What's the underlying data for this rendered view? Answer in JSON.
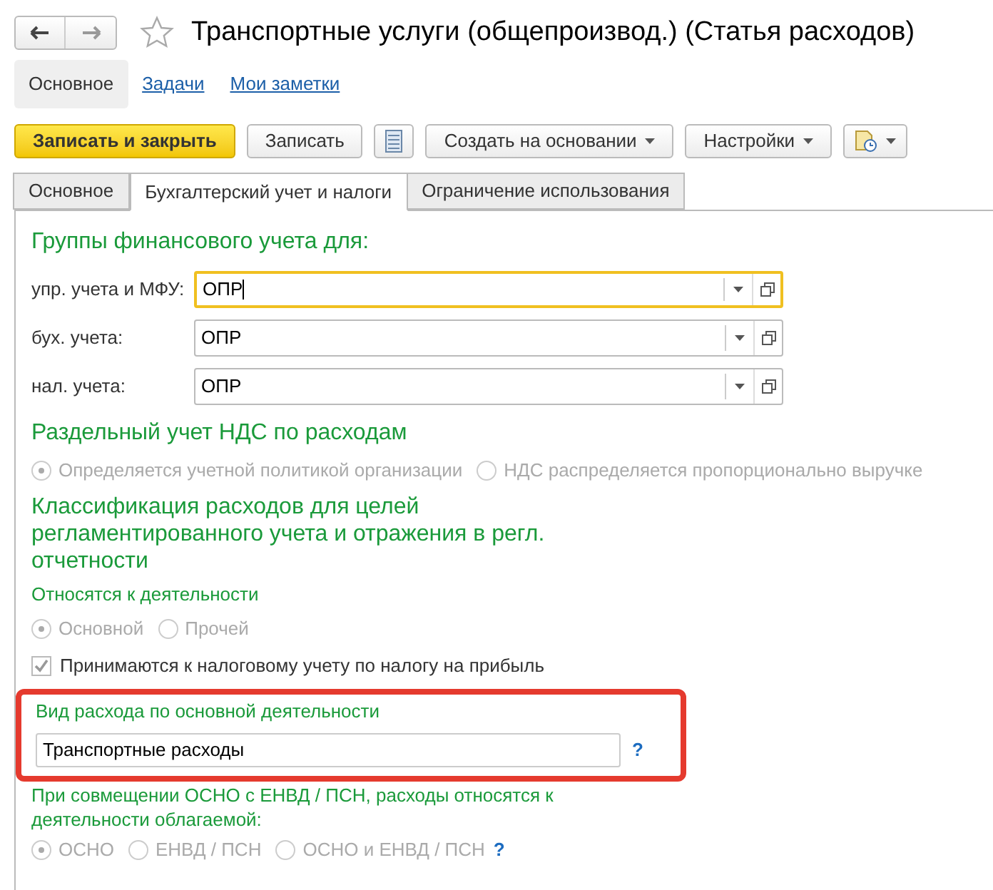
{
  "window": {
    "title": "Транспортные услуги (общепроизвод.) (Статья расходов)",
    "favorite": false
  },
  "subnav": [
    {
      "label": "Основное",
      "selected": true
    },
    {
      "label": "Задачи",
      "selected": false
    },
    {
      "label": "Мои заметки",
      "selected": false
    }
  ],
  "toolbar": [
    {
      "kind": "primary",
      "label": "Записать и закрыть"
    },
    {
      "kind": "button",
      "label": "Записать"
    },
    {
      "kind": "list"
    },
    {
      "kind": "dropdown",
      "label": "Создать на основании"
    },
    {
      "kind": "dropdown",
      "label": "Настройки"
    },
    {
      "kind": "report"
    }
  ],
  "tabs": [
    {
      "label": "Основное",
      "selected": false
    },
    {
      "label": "Бухгалтерский учет и налоги",
      "selected": true
    },
    {
      "label": "Ограничение использования",
      "selected": false
    }
  ],
  "fin_groups": {
    "title": "Группы финансового учета для:",
    "fields": [
      {
        "label": "упр. учета и МФУ:",
        "value": "ОПР",
        "focused": true
      },
      {
        "label": "бух. учета:",
        "value": "ОПР",
        "focused": false
      },
      {
        "label": "нал. учета:",
        "value": "ОПР",
        "focused": false
      }
    ]
  },
  "vat": {
    "title": "Раздельный учет НДС по расходам",
    "disabled": true,
    "options": [
      {
        "label": "Определяется учетной политикой организации",
        "selected": true
      },
      {
        "label": "НДС распределяется пропорционально выручке",
        "selected": false
      }
    ]
  },
  "classification": {
    "title": "Классификация расходов для целей регламентированного учета и отражения в регл. отчетности",
    "activity": {
      "label": "Относятся к деятельности",
      "disabled": true,
      "options": [
        {
          "label": "Основной",
          "selected": true
        },
        {
          "label": "Прочей",
          "selected": false
        }
      ]
    },
    "tax_checkbox": {
      "label": "Принимаются к налоговому учету по налогу на прибыль",
      "checked": true,
      "disabled": true
    },
    "expense_type": {
      "label": "Вид расхода по основной деятельности",
      "value": "Транспортные расходы",
      "help": "?",
      "highlighted": true
    },
    "combined": {
      "label": "При совмещении ОСНО с ЕНВД / ПСН, расходы относятся к деятельности облагаемой:",
      "disabled": true,
      "help": "?",
      "options": [
        {
          "label": "ОСНО",
          "selected": true
        },
        {
          "label": "ЕНВД / ПСН",
          "selected": false
        },
        {
          "label": "ОСНО и ЕНВД / ПСН",
          "selected": false
        }
      ]
    }
  }
}
